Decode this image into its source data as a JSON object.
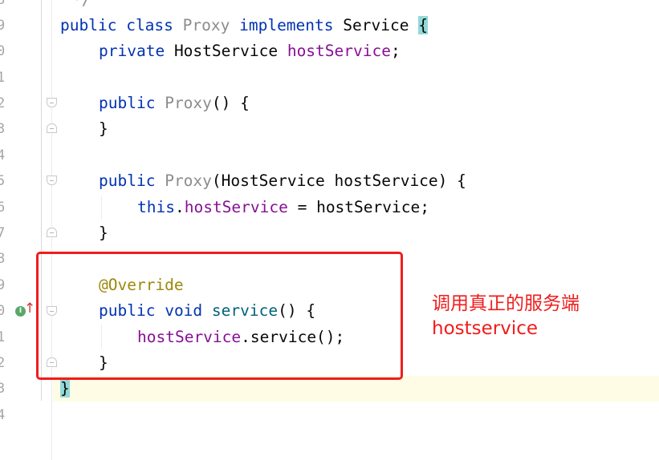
{
  "line_numbers": [
    "8",
    "9",
    "0",
    "1",
    "2",
    "3",
    "4",
    "5",
    "6",
    "7",
    "8",
    "9",
    "0",
    "1",
    "2",
    "3",
    "4"
  ],
  "code": {
    "comment_end": "*/",
    "l19": {
      "kw1": "public",
      "kw2": "class",
      "cls": "Proxy",
      "kw3": "implements",
      "iface": "Service",
      "brace": "{"
    },
    "l20": {
      "kw": "private",
      "type": "HostService",
      "field": "hostService",
      "punct": ";"
    },
    "l22": {
      "kw": "public",
      "name": "Proxy",
      "rest": "() {"
    },
    "l23": {
      "text": "}"
    },
    "l25": {
      "kw": "public",
      "name": "Proxy",
      "rest": "(HostService hostService) {"
    },
    "l26": {
      "kw": "this",
      "dot": ".",
      "field": "hostService",
      "rest": " = hostService;"
    },
    "l27": {
      "text": "}"
    },
    "l29": {
      "annotation": "@Override"
    },
    "l30": {
      "kw1": "public",
      "kw2": "void",
      "method": "service",
      "rest": "() {"
    },
    "l31": {
      "field": "hostService",
      "rest": ".service();"
    },
    "l32": {
      "text": "}"
    },
    "l33": {
      "brace": "}"
    }
  },
  "annotation_note": {
    "line1": "调用真正的服务端",
    "line2": "hostservice"
  },
  "gutter_icons": {
    "implements_badge": "I",
    "override_arrow": "↑"
  },
  "colors": {
    "keyword": "#0033b3",
    "field": "#871094",
    "method": "#00627a",
    "annotation": "#9e880d",
    "red_markup": "#f01c1c",
    "brace_match": "#93d9d9"
  }
}
